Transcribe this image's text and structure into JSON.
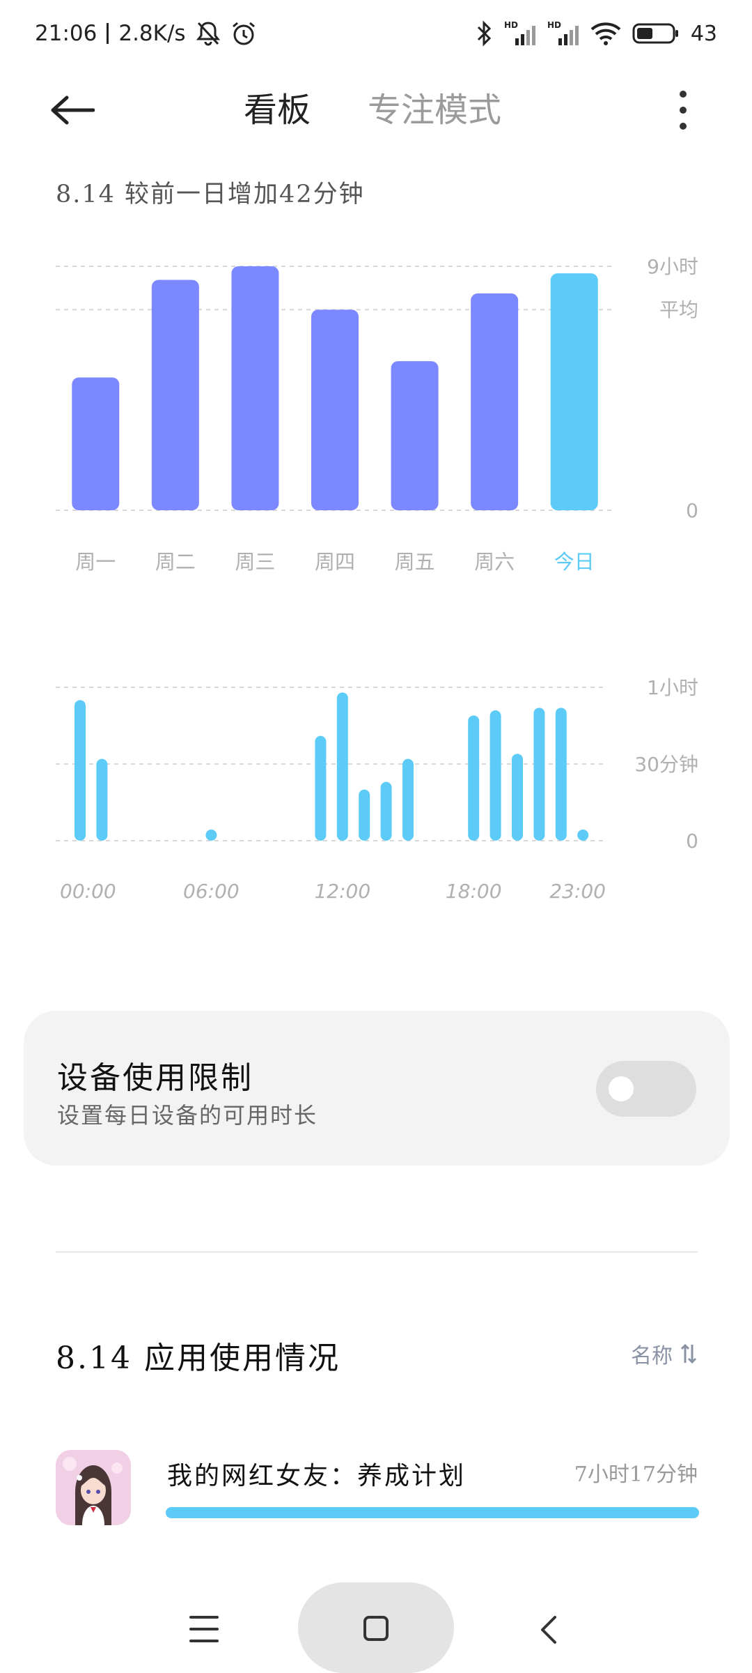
{
  "status_bar": {
    "time": "21:06",
    "speed": "2.8K/s",
    "battery": "43"
  },
  "header": {
    "tab_active": "看板",
    "tab_inactive": "专注模式"
  },
  "summary": {
    "compare_text": "8.14 较前一日增加42分钟"
  },
  "weekly_chart": {
    "type": "bar",
    "categories": [
      "周一",
      "周二",
      "周三",
      "周四",
      "周五",
      "周六",
      "今日"
    ],
    "values": [
      4.9,
      8.5,
      9.0,
      7.4,
      5.5,
      8.0,
      8.74
    ],
    "highlight_index": 6,
    "ylim": [
      0,
      9
    ],
    "average": 7.4,
    "ytick_labels": {
      "max": "9小时",
      "avg": "平均",
      "zero": "0"
    },
    "colors": {
      "bar": "#7b88ff",
      "highlight": "#5ccbf7",
      "grid": "#d8d8d8",
      "label": "#b0b0b0",
      "highlight_label": "#5ccbf7"
    }
  },
  "hourly_chart": {
    "type": "bar",
    "x": [
      0,
      1,
      2,
      3,
      4,
      5,
      6,
      7,
      8,
      9,
      10,
      11,
      12,
      13,
      14,
      15,
      16,
      17,
      18,
      19,
      20,
      21,
      22,
      23
    ],
    "values": [
      55,
      32,
      0,
      0,
      0,
      0,
      0.5,
      0,
      0,
      0,
      0,
      41,
      58,
      20,
      23,
      32,
      0,
      0,
      49,
      51,
      34,
      52,
      52,
      3
    ],
    "ylim": [
      0,
      60
    ],
    "ytick_labels": [
      "0",
      "30分钟",
      "1小时"
    ],
    "xtick_labels": [
      "00:00",
      "06:00",
      "12:00",
      "18:00",
      "23:00"
    ],
    "colors": {
      "bar": "#5ccbf7",
      "grid": "#d8d8d8",
      "label": "#b0b0b0"
    }
  },
  "device_limit": {
    "title": "设备使用限制",
    "subtitle": "设置每日设备的可用时长",
    "enabled": false
  },
  "app_usage": {
    "title": "8.14 应用使用情况",
    "sort_label": "名称",
    "apps": [
      {
        "name": "我的网红女友：养成计划",
        "time": "7小时17分钟",
        "fraction": 1.0
      }
    ],
    "bar_color": "#5ccbf7"
  },
  "chart_data": [
    {
      "type": "bar",
      "categories": [
        "周一",
        "周二",
        "周三",
        "周四",
        "周五",
        "周六",
        "今日"
      ],
      "values": [
        4.9,
        8.5,
        9.0,
        7.4,
        5.5,
        8.0,
        8.74
      ],
      "title": "",
      "xlabel": "",
      "ylabel": "",
      "ylim": [
        0,
        9
      ],
      "ytick_labels": [
        "0",
        "平均",
        "9小时"
      ],
      "grid": true
    },
    {
      "type": "bar",
      "categories": [
        "00:00",
        "01:00",
        "02:00",
        "03:00",
        "04:00",
        "05:00",
        "06:00",
        "07:00",
        "08:00",
        "09:00",
        "10:00",
        "11:00",
        "12:00",
        "13:00",
        "14:00",
        "15:00",
        "16:00",
        "17:00",
        "18:00",
        "19:00",
        "20:00",
        "21:00",
        "22:00",
        "23:00"
      ],
      "values": [
        55,
        32,
        0,
        0,
        0,
        0,
        0.5,
        0,
        0,
        0,
        0,
        41,
        58,
        20,
        23,
        32,
        0,
        0,
        49,
        51,
        34,
        52,
        52,
        3
      ],
      "title": "",
      "xlabel": "",
      "ylabel": "",
      "ylim": [
        0,
        60
      ],
      "ytick_labels": [
        "0",
        "30分钟",
        "1小时"
      ],
      "xtick_labels": [
        "00:00",
        "06:00",
        "12:00",
        "18:00",
        "23:00"
      ],
      "grid": true
    }
  ]
}
